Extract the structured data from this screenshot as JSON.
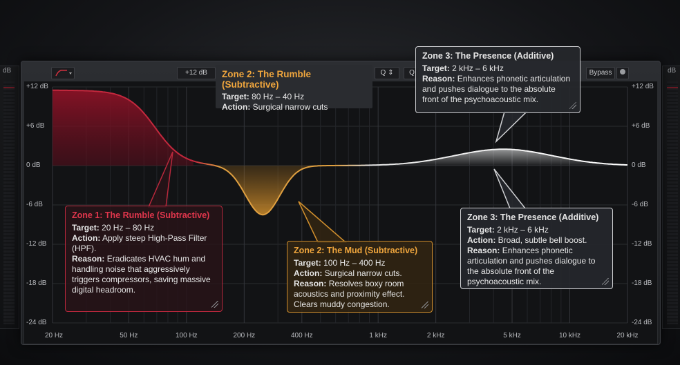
{
  "meters": {
    "left_label": "dB",
    "right_label": "dB"
  },
  "toolbar": {
    "gain_range": "+12 dB",
    "q_label": "Q",
    "q_label2": "Q",
    "bypass": "Bypass"
  },
  "db_labels": [
    "+12 dB",
    "+6 dB",
    "0 dB",
    "-6 dB",
    "-12 dB",
    "-18 dB",
    "-24 dB"
  ],
  "freq_labels": [
    "20 Hz",
    "50 Hz",
    "100 Hz",
    "200 Hz",
    "400 Hz",
    "1 kHz",
    "2 kHz",
    "5 kHz",
    "10 kHz",
    "20 kHz"
  ],
  "bands": [
    {
      "name": "Zone 1",
      "type": "high-pass",
      "cutoff_hz": 80,
      "color": "#b9283c"
    },
    {
      "name": "Zone 2",
      "type": "bell",
      "freq_hz": 250,
      "gain_db": -7.5,
      "color": "#d18f2d"
    },
    {
      "name": "Zone 3",
      "type": "bell",
      "freq_hz": 4500,
      "gain_db": 2.5,
      "color": "#e6e6e6"
    }
  ],
  "callouts": {
    "zone1": {
      "title": "Zone 1: The Rumble (Subtractive)",
      "target_label": "Target:",
      "target": "20 Hz – 80 Hz",
      "action_label": "Action:",
      "action": "Apply steep High-Pass Filter (HPF).",
      "reason_label": "Reason:",
      "reason": "Eradicates HVAC hum and handling noise that aggressively triggers compressors, saving massive digital headroom."
    },
    "zone2": {
      "title": "Zone 2: The Mud (Subtractive)",
      "target_label": "Target:",
      "target": "100 Hz – 400 Hz",
      "action_label": "Action:",
      "action": "Surgical narrow cuts.",
      "reason_label": "Reason:",
      "reason": "Resolves boxy room acoustics and proximity effect. Clears muddy congestion."
    },
    "zone3": {
      "title": "Zone 3: The Presence (Additive)",
      "target_label": "Target:",
      "target": "2 kHz – 6 kHz",
      "action_label": "Action:",
      "action": "Broad, subtle bell boost.",
      "reason_label": "Reason:",
      "reason": "Enhances phonetic articulation and pushes dialogue to the absolute front of the psychoacoustic mix."
    },
    "zone3_top": {
      "title": "Zone 3: The Presence (Additive)",
      "target_label": "Target:",
      "target": "2 kHz – 6 kHz",
      "reason_label": "Reason:",
      "reason": "Enhances phonetic articulation and pushes dialogue to the absolute front of the psychoacoustic mix."
    },
    "rumble_top": {
      "title": "Zone 2: The Rumble (Subtractive)",
      "target_label": "Target:",
      "target": "80 Hz – 40 Hz",
      "action_label": "Action:",
      "action": "Surgical narrow cuts"
    }
  }
}
